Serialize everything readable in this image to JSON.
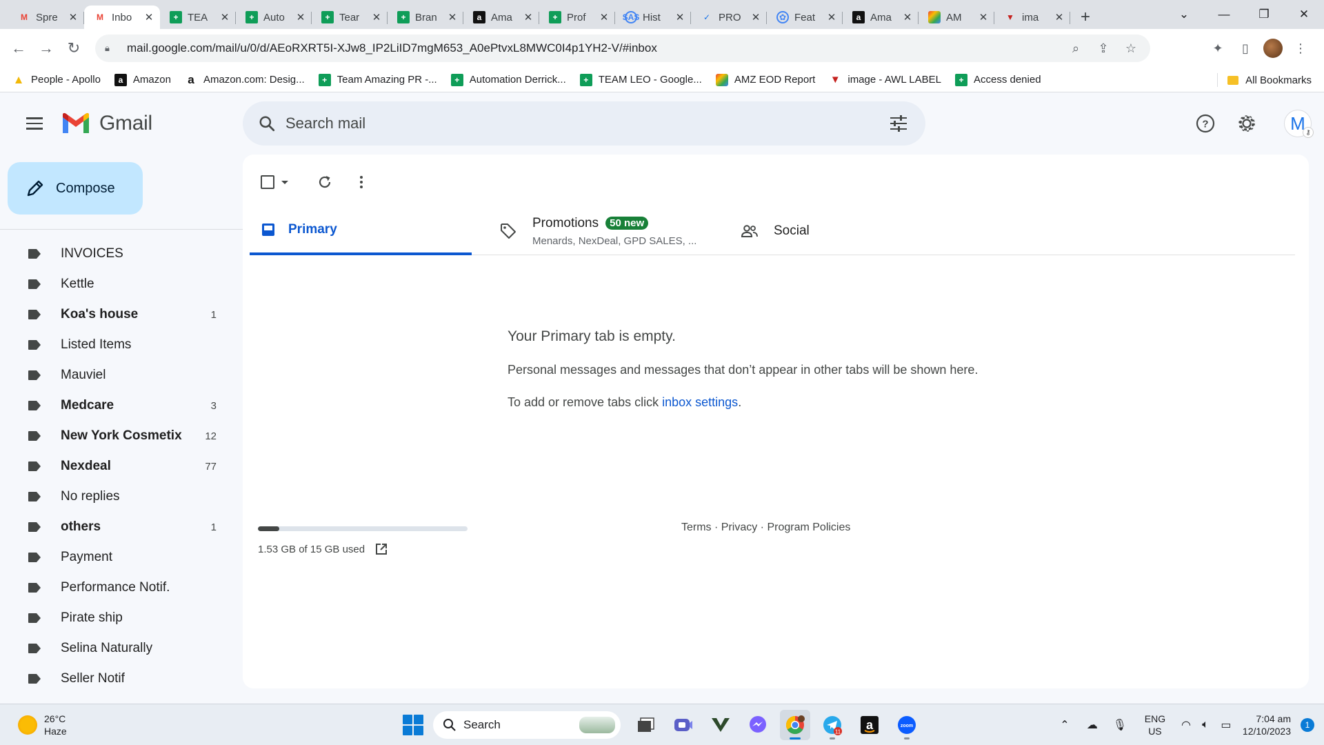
{
  "browser": {
    "tabs": [
      {
        "title": "Spre",
        "favicon": "gmail-icon"
      },
      {
        "title": "Inbo",
        "favicon": "gmail-icon",
        "active": true
      },
      {
        "title": "TEA",
        "favicon": "sheets-icon"
      },
      {
        "title": "Auto",
        "favicon": "sheets-icon"
      },
      {
        "title": "Tear",
        "favicon": "sheets-icon"
      },
      {
        "title": "Bran",
        "favicon": "sheets-icon"
      },
      {
        "title": "Ama",
        "favicon": "amazon-icon"
      },
      {
        "title": "Prof",
        "favicon": "sheets-icon"
      },
      {
        "title": "Hist",
        "favicon": "globe-icon"
      },
      {
        "title": "PRO",
        "favicon": "check-icon"
      },
      {
        "title": "Feat",
        "favicon": "feature-icon"
      },
      {
        "title": "Ama",
        "favicon": "amazon-icon"
      },
      {
        "title": "AM",
        "favicon": "amz-multicolor-icon"
      },
      {
        "title": "ima",
        "favicon": "awl-icon"
      }
    ],
    "url": "mail.google.com/mail/u/0/d/AEoRXRT5I-XJw8_IP2LiID7mgM653_A0ePtvxL8MWC0I4p1YH2-V/#inbox",
    "bookmarks": [
      {
        "label": "People - Apollo",
        "icon": "apollo-icon"
      },
      {
        "label": "Amazon",
        "icon": "amazon-icon"
      },
      {
        "label": "Amazon.com: Desig...",
        "icon": "amazon-icon"
      },
      {
        "label": "Team Amazing PR -...",
        "icon": "sheets-icon"
      },
      {
        "label": "Automation Derrick...",
        "icon": "sheets-icon"
      },
      {
        "label": "TEAM LEO - Google...",
        "icon": "sheets-icon"
      },
      {
        "label": "AMZ EOD Report",
        "icon": "amz-multicolor-icon"
      },
      {
        "label": "image - AWL LABEL",
        "icon": "awl-icon"
      },
      {
        "label": "Access denied",
        "icon": "sheets-icon"
      }
    ],
    "all_bookmarks": "All Bookmarks"
  },
  "gmail": {
    "logo_text": "Gmail",
    "search_placeholder": "Search mail",
    "avatar_letter": "M",
    "compose_label": "Compose",
    "labels": [
      {
        "name": "INVOICES",
        "count": "",
        "bold": false
      },
      {
        "name": "Kettle",
        "count": "",
        "bold": false
      },
      {
        "name": "Koa's house",
        "count": "1",
        "bold": true
      },
      {
        "name": "Listed Items",
        "count": "",
        "bold": false
      },
      {
        "name": "Mauviel",
        "count": "",
        "bold": false
      },
      {
        "name": "Medcare",
        "count": "3",
        "bold": true
      },
      {
        "name": "New York Cosmetix",
        "count": "12",
        "bold": true
      },
      {
        "name": "Nexdeal",
        "count": "77",
        "bold": true
      },
      {
        "name": "No replies",
        "count": "",
        "bold": false
      },
      {
        "name": "others",
        "count": "1",
        "bold": true
      },
      {
        "name": "Payment",
        "count": "",
        "bold": false
      },
      {
        "name": "Performance Notif.",
        "count": "",
        "bold": false
      },
      {
        "name": "Pirate ship",
        "count": "",
        "bold": false
      },
      {
        "name": "Selina Naturally",
        "count": "",
        "bold": false
      },
      {
        "name": "Seller Notif",
        "count": "",
        "bold": false
      }
    ],
    "tabs": {
      "primary": "Primary",
      "promotions": "Promotions",
      "promotions_badge": "50 new",
      "promotions_senders": "Menards, NexDeal, GPD SALES, ...",
      "social": "Social"
    },
    "empty": {
      "title": "Your Primary tab is empty.",
      "message": "Personal messages and messages that don’t appear in other tabs will be shown here.",
      "settings_prefix": "To add or remove tabs click ",
      "settings_link": "inbox settings",
      "settings_suffix": "."
    },
    "storage": {
      "text": "1.53 GB of 15 GB used",
      "used_fraction": 0.102
    },
    "footer": {
      "terms": "Terms",
      "privacy": "Privacy",
      "policies": "Program Policies",
      "separator": " · "
    }
  },
  "taskbar": {
    "weather_temp": "26°C",
    "weather_desc": "Haze",
    "search_label": "Search",
    "lang_line1": "ENG",
    "lang_line2": "US",
    "time": "7:04 am",
    "date": "12/10/2023",
    "notification_count": "1",
    "telegram_badge": "11"
  },
  "colors": {
    "accent": "#0b57d0",
    "compose_bg": "#c2e7ff",
    "promotions_badge": "#188038"
  }
}
